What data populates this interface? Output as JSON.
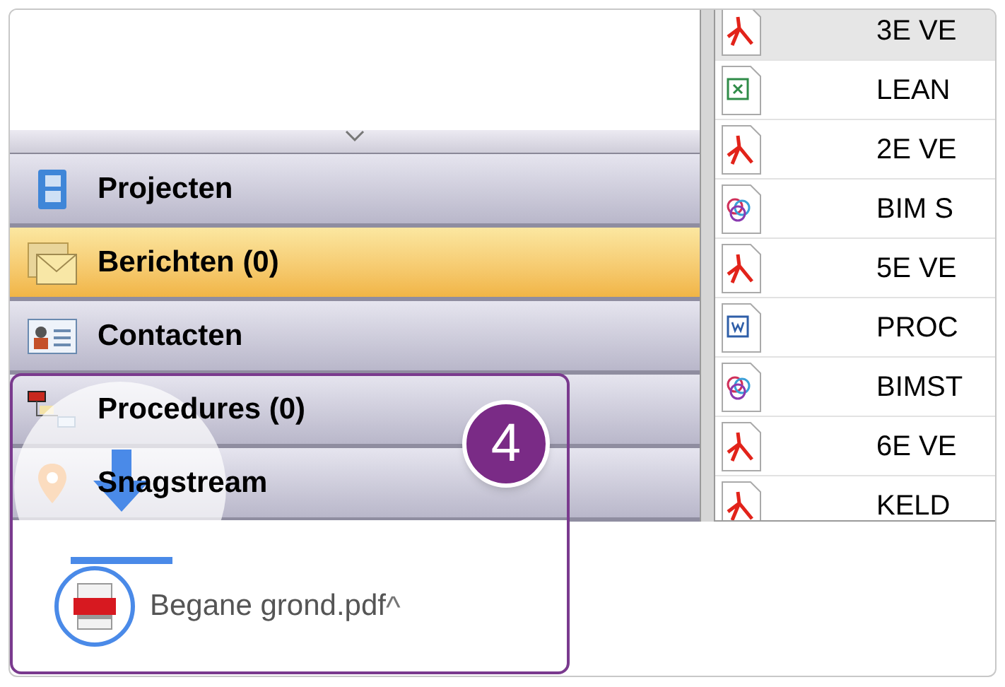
{
  "nav_items": [
    {
      "label": "Projecten",
      "kind": "projects",
      "selected": false
    },
    {
      "label": "Berichten (0)",
      "kind": "messages",
      "selected": true
    },
    {
      "label": "Contacten",
      "kind": "contacts",
      "selected": false
    },
    {
      "label": "Procedures (0)",
      "kind": "procedures",
      "selected": false
    },
    {
      "label": "Snagstream",
      "kind": "pin",
      "selected": false
    }
  ],
  "files": [
    {
      "kind": "pdf",
      "name": "3E VE",
      "selected": true
    },
    {
      "kind": "excel",
      "name": "LEAN",
      "selected": false
    },
    {
      "kind": "pdf",
      "name": "2E VE",
      "selected": false
    },
    {
      "kind": "web",
      "name": "BIM S",
      "selected": false
    },
    {
      "kind": "pdf",
      "name": "5E VE",
      "selected": false
    },
    {
      "kind": "word",
      "name": "PROC",
      "selected": false
    },
    {
      "kind": "web",
      "name": "BIMST",
      "selected": false
    },
    {
      "kind": "pdf",
      "name": "6E VE",
      "selected": false
    },
    {
      "kind": "pdf",
      "name": "KELD",
      "selected": false
    }
  ],
  "download": {
    "filename": "Begane grond.pdf",
    "caret": "^"
  },
  "callout": {
    "number": "4"
  }
}
